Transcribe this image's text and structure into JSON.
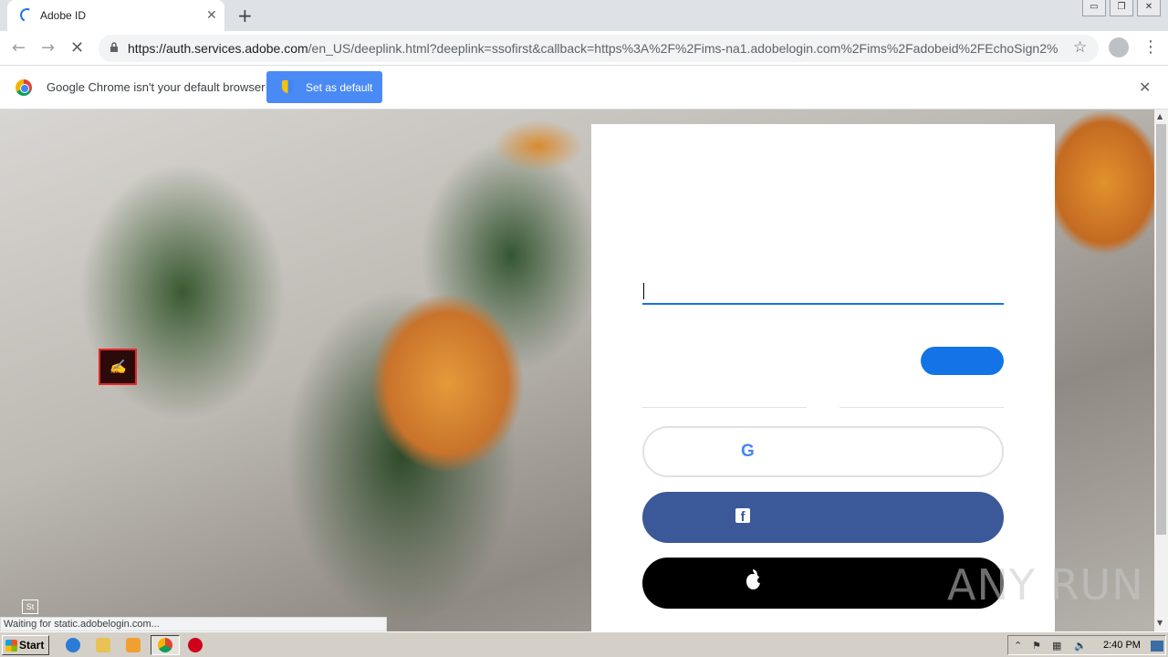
{
  "browser": {
    "tab_title": "Adobe ID",
    "new_tab_symbol": "+",
    "tab_close_symbol": "✕",
    "url_host": "https://auth.services.adobe.com",
    "url_path": "/en_US/deeplink.html?deeplink=ssofirst&callback=https%3A%2F%2Fims-na1.adobelogin.com%2Fims%2Fadobeid%2FEchoSign2%...",
    "window_controls": [
      "▭",
      "❐",
      "✕"
    ]
  },
  "infobar": {
    "message": "Google Chrome isn't your default browser",
    "set_default_label": "Set as default",
    "close_symbol": "✕"
  },
  "page": {
    "email_value": "",
    "status_text": "Waiting for static.adobelogin.com...",
    "st_badge": "St",
    "google_letter": "G",
    "facebook_letter": "f"
  },
  "watermark": "ANY RUN",
  "taskbar": {
    "start_label": "Start",
    "clock": "2:40 PM"
  },
  "colors": {
    "adobe_blue": "#1473e6",
    "facebook_blue": "#3b5998",
    "apple_black": "#000000",
    "chrome_button_blue": "#4a8af4"
  },
  "icons": [
    "loading-spinner-icon",
    "back-icon",
    "forward-icon",
    "stop-reload-icon",
    "lock-icon",
    "star-icon",
    "profile-icon",
    "menu-icon",
    "chrome-logo-icon",
    "shield-icon",
    "adobe-sign-icon",
    "google-icon",
    "facebook-icon",
    "apple-icon"
  ]
}
